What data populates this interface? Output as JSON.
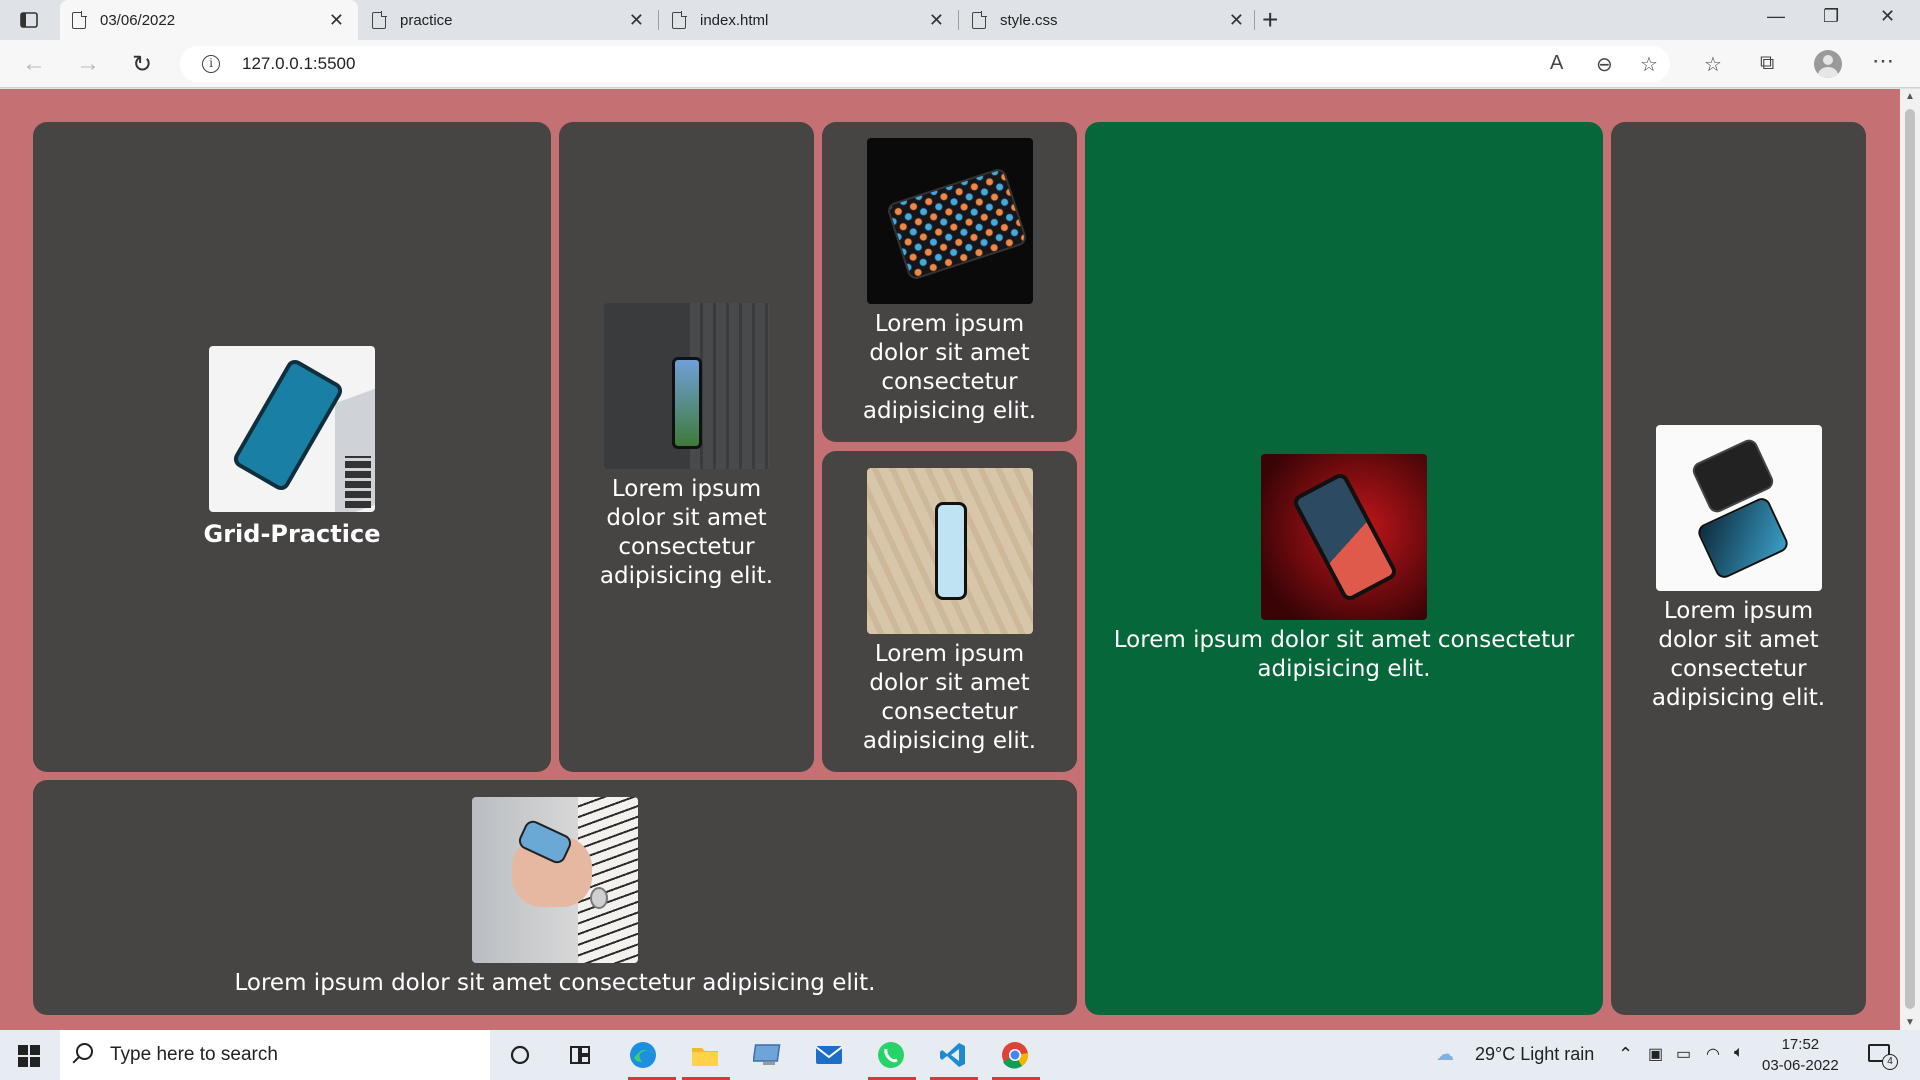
{
  "browser": {
    "tabs": [
      {
        "label": "03/06/2022",
        "active": true
      },
      {
        "label": "practice",
        "active": false
      },
      {
        "label": "index.html",
        "active": false
      },
      {
        "label": "style.css",
        "active": false
      }
    ],
    "url": "127.0.0.1:5500"
  },
  "page": {
    "title_card": {
      "title": "Grid-Practice"
    },
    "lorem_short": "Lorem ipsum dolor sit amet consectetur adipisicing elit.",
    "cards": {
      "card2": "Lorem ipsum dolor sit amet consectetur adipisicing elit.",
      "card3": "Lorem ipsum dolor sit amet consectetur adipisicing elit.",
      "card4": "Lorem ipsum dolor sit amet consectetur adipisicing elit.",
      "card5": "Lorem ipsum dolor sit amet consectetur adipisicing elit.",
      "card6": "Lorem ipsum dolor sit amet consectetur adipisicing elit.",
      "card7": "Lorem ipsum dolor sit amet consectetur adipisicing elit."
    },
    "colors": {
      "background": "#c57073",
      "card": "#474444",
      "card_green": "#06683a"
    }
  },
  "taskbar": {
    "search_placeholder": "Type here to search",
    "weather": "29°C  Light rain",
    "time": "17:52",
    "date": "03-06-2022",
    "notification_count": "4"
  }
}
